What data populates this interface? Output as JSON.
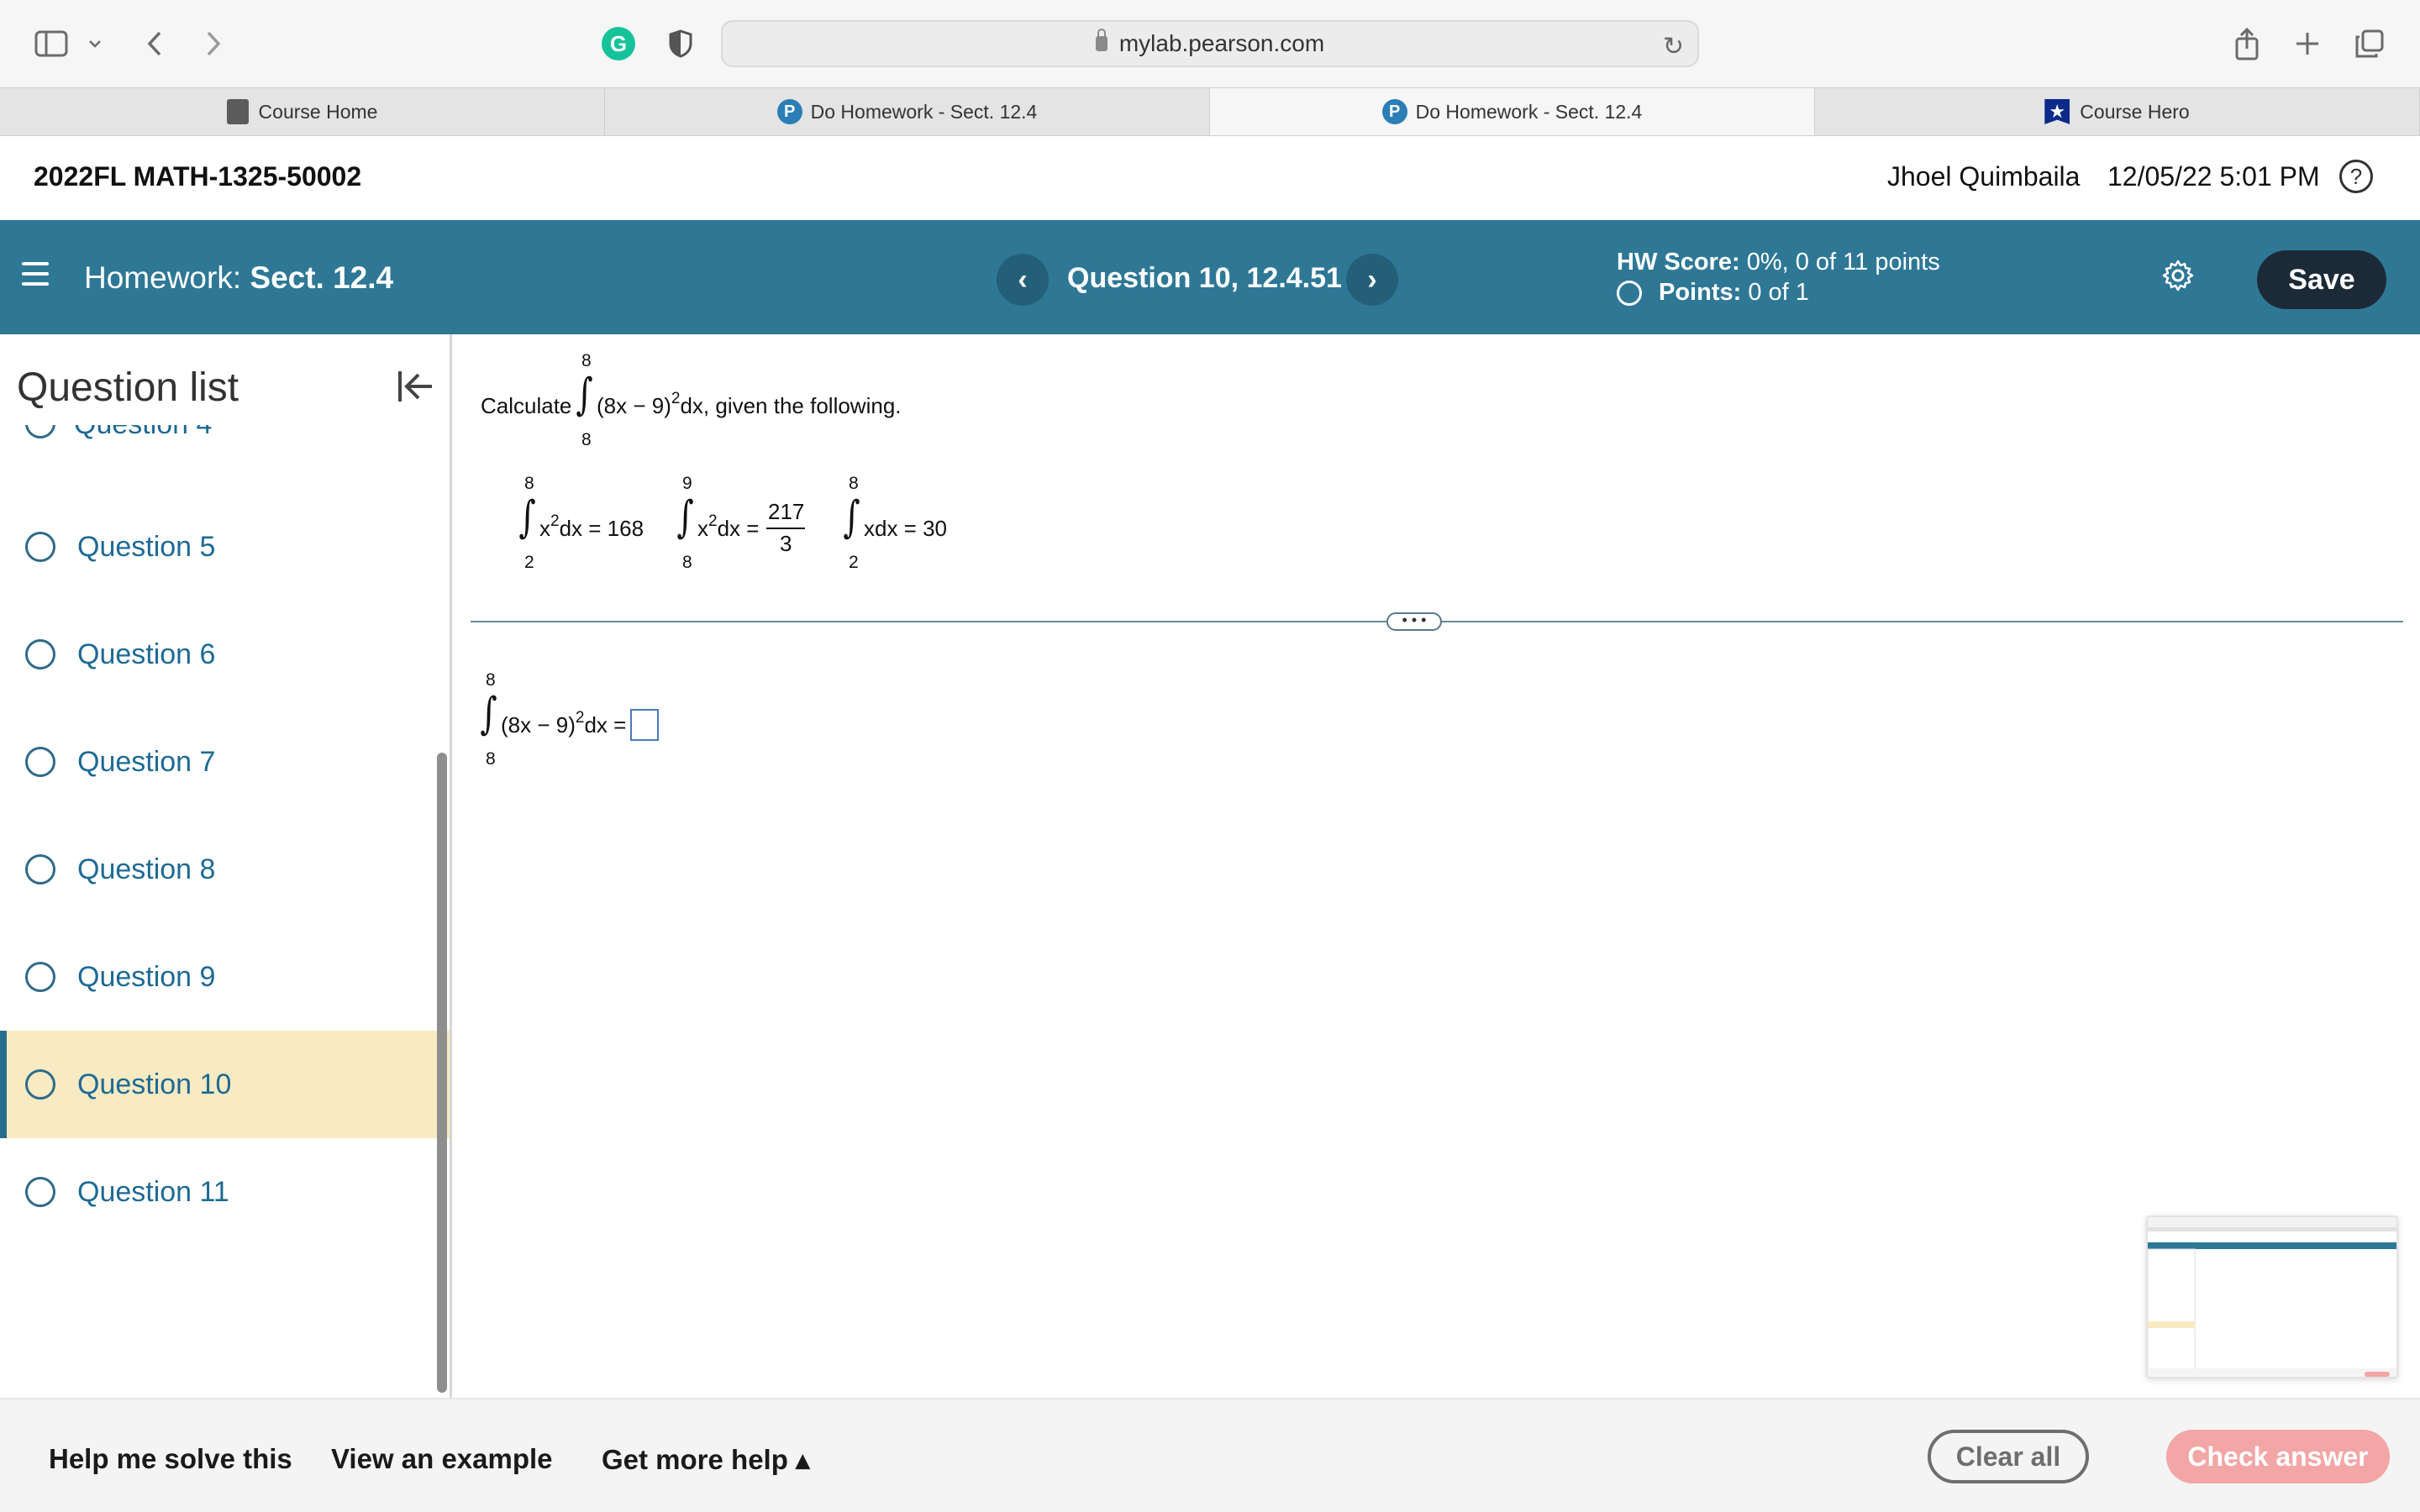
{
  "browser": {
    "url": "mylab.pearson.com",
    "tabs": [
      {
        "label": "Course Home",
        "icon": "book-icon",
        "active": false
      },
      {
        "label": "Do Homework - Sect. 12.4",
        "icon": "pearson-icon",
        "active": false
      },
      {
        "label": "Do Homework - Sect. 12.4",
        "icon": "pearson-icon",
        "active": true
      },
      {
        "label": "Course Hero",
        "icon": "coursehero-icon",
        "active": false
      }
    ],
    "extension_letter": "G"
  },
  "course": {
    "title": "2022FL MATH-1325-50002",
    "user": "Jhoel Quimbaila",
    "datetime": "12/05/22 5:01 PM",
    "help_symbol": "?"
  },
  "header": {
    "hw_label": "Homework:",
    "hw_name": "Sect. 12.4",
    "question_title": "Question 10, 12.4.51",
    "prev_symbol": "‹",
    "next_symbol": "›",
    "hw_score_label": "HW Score:",
    "hw_score_value": "0%, 0 of 11 points",
    "points_label": "Points:",
    "points_value": "0 of 1",
    "save_label": "Save",
    "accent": "#2e7896"
  },
  "sidebar": {
    "title": "Question list",
    "partial_item": "Question 4",
    "items": [
      {
        "label": "Question 5",
        "current": false
      },
      {
        "label": "Question 6",
        "current": false
      },
      {
        "label": "Question 7",
        "current": false
      },
      {
        "label": "Question 8",
        "current": false
      },
      {
        "label": "Question 9",
        "current": false
      },
      {
        "label": "Question 10",
        "current": true
      },
      {
        "label": "Question 11",
        "current": false
      }
    ]
  },
  "problem": {
    "prompt_prefix": "Calculate",
    "main_integral": {
      "lower": "8",
      "upper": "8",
      "integrand_a": "(8x − 9)",
      "exp": "2",
      "integrand_b": "dx, given the following."
    },
    "givens": [
      {
        "lower": "2",
        "upper": "8",
        "a": "x",
        "exp": "2",
        "b": "dx = 168"
      },
      {
        "lower": "8",
        "upper": "9",
        "a": "x",
        "exp": "2",
        "b": "dx =",
        "frac_num": "217",
        "frac_den": "3"
      },
      {
        "lower": "2",
        "upper": "8",
        "a": "xdx = 30"
      }
    ],
    "answer": {
      "lower": "8",
      "upper": "8",
      "a": "(8x − 9)",
      "exp": "2",
      "b": "dx =",
      "value": ""
    }
  },
  "divider_handle": "• • •",
  "footer": {
    "help_solve": "Help me solve this",
    "view_example": "View an example",
    "more_help": "Get more help ▴",
    "clear_all": "Clear all",
    "check_answer": "Check answer",
    "check_color": "#f2a6a6"
  }
}
